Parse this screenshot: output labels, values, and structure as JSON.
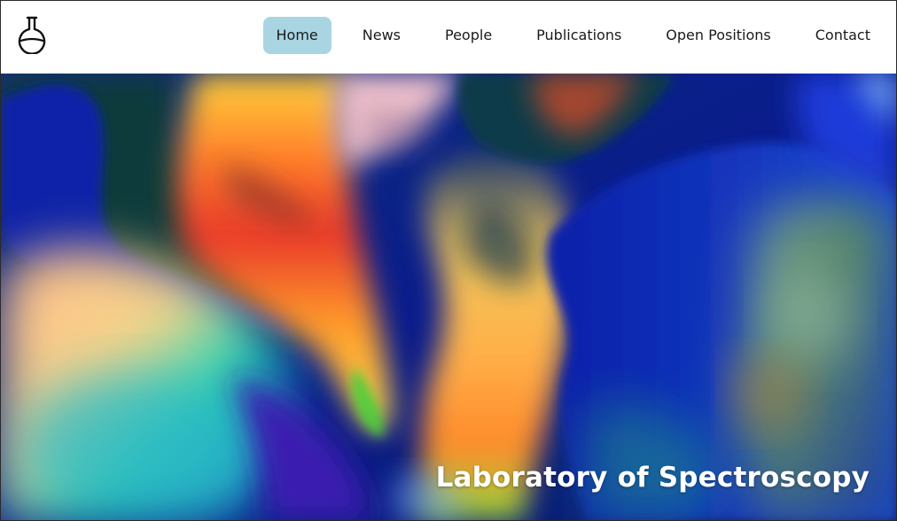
{
  "header": {
    "logo_icon": "flask-icon",
    "nav": [
      {
        "label": "Home",
        "active": true
      },
      {
        "label": "News",
        "active": false
      },
      {
        "label": "People",
        "active": false
      },
      {
        "label": "Publications",
        "active": false
      },
      {
        "label": "Open Positions",
        "active": false
      },
      {
        "label": "Contact",
        "active": false
      }
    ],
    "active_color": "#a9d5e3"
  },
  "hero": {
    "title": "Laboratory of Spectroscopy",
    "image_icon": "abstract-fluid-gradient-image"
  }
}
